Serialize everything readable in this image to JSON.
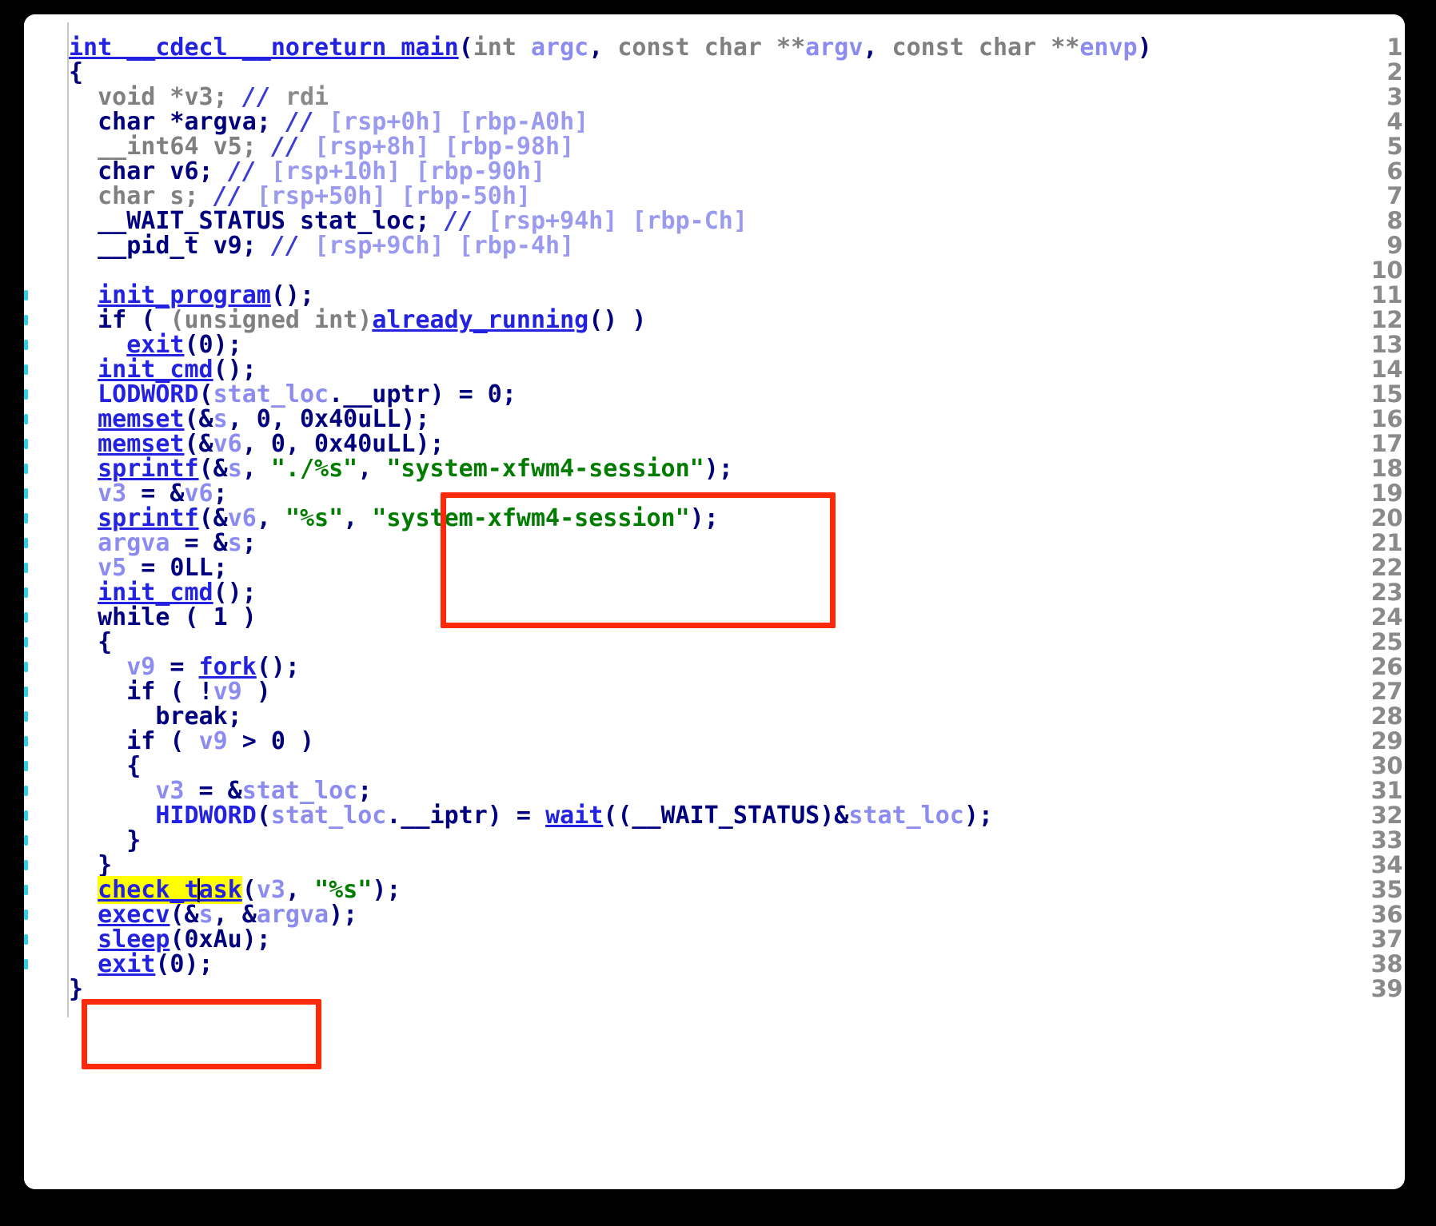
{
  "window": {
    "kind": "decompiler-pseudocode-view",
    "background": "#000000",
    "panel_background": "#ffffff"
  },
  "colors": {
    "keyword": "#00007e",
    "type_gray": "#808080",
    "function": "#2222e0",
    "variable": "#8c8cf0",
    "string": "#007c00",
    "comment": "#9a9aee",
    "highlight": "#ffff00",
    "annotation_box": "#fb2a0a",
    "gutter_text": "#8a8a8a",
    "edge_marker": "#2fd0e8"
  },
  "gutter": {
    "line_numbers": [
      "1",
      "2",
      "3",
      "4",
      "5",
      "6",
      "7",
      "8",
      "9",
      "10",
      "11",
      "12",
      "13",
      "14",
      "15",
      "16",
      "17",
      "18",
      "19",
      "20",
      "21",
      "22",
      "23",
      "24",
      "25",
      "26",
      "27",
      "28",
      "29",
      "30",
      "31",
      "32",
      "33",
      "34",
      "35",
      "36",
      "37",
      "38",
      "39"
    ],
    "marked_lines": [
      11,
      12,
      13,
      14,
      15,
      16,
      17,
      18,
      19,
      20,
      21,
      22,
      23,
      24,
      25,
      26,
      27,
      28,
      29,
      30,
      31,
      32,
      33,
      34,
      35,
      36,
      37,
      38
    ]
  },
  "code": {
    "language": "c-pseudocode",
    "function_signature": "int __cdecl __noreturn main(int argc, const char **argv, const char **envp)",
    "highlighted_identifier": "check_task",
    "caret_after": "check_t",
    "lines": [
      "int __cdecl __noreturn main(int argc, const char **argv, const char **envp)",
      "{",
      "  void *v3; // rdi",
      "  char *argva; // [rsp+0h] [rbp-A0h]",
      "  __int64 v5; // [rsp+8h] [rbp-98h]",
      "  char v6; // [rsp+10h] [rbp-90h]",
      "  char s; // [rsp+50h] [rbp-50h]",
      "  __WAIT_STATUS stat_loc; // [rsp+94h] [rbp-Ch]",
      "  __pid_t v9; // [rsp+9Ch] [rbp-4h]",
      "",
      "  init_program();",
      "  if ( (unsigned int)already_running() )",
      "    exit(0);",
      "  init_cmd();",
      "  LODWORD(stat_loc.__uptr) = 0;",
      "  memset(&s, 0, 0x40uLL);",
      "  memset(&v6, 0, 0x40uLL);",
      "  sprintf(&s, \"./%s\", \"system-xfwm4-session\");",
      "  v3 = &v6;",
      "  sprintf(&v6, \"%s\", \"system-xfwm4-session\");",
      "  argva = &s;",
      "  v5 = 0LL;",
      "  init_cmd();",
      "  while ( 1 )",
      "  {",
      "    v9 = fork();",
      "    if ( !v9 )",
      "      break;",
      "    if ( v9 > 0 )",
      "    {",
      "      v3 = &stat_loc;",
      "      HIDWORD(stat_loc.__iptr) = wait((__WAIT_STATUS)&stat_loc);",
      "    }",
      "  }",
      "  check_task(v3, \"%s\");",
      "  execv(&s, &argva);",
      "  sleep(0xAu);",
      "  exit(0);",
      "}"
    ],
    "strings": [
      "system-xfwm4-session",
      "./%s",
      "%s"
    ],
    "functions": [
      "main",
      "init_program",
      "already_running",
      "exit",
      "init_cmd",
      "LODWORD",
      "memset",
      "sprintf",
      "fork",
      "HIDWORD",
      "wait",
      "check_task",
      "execv",
      "sleep"
    ],
    "variables": [
      "v3",
      "argva",
      "v5",
      "v6",
      "s",
      "stat_loc",
      "v9",
      "argc",
      "argv",
      "envp"
    ],
    "comments": [
      "// rdi",
      "// [rsp+0h] [rbp-A0h]",
      "// [rsp+8h] [rbp-98h]",
      "// [rsp+10h] [rbp-90h]",
      "// [rsp+50h] [rbp-50h]",
      "// [rsp+94h] [rbp-Ch]",
      "// [rsp+9Ch] [rbp-4h]"
    ]
  },
  "annotations": [
    {
      "name": "string-literal-box",
      "target": "system-xfwm4-session string arguments on lines 17-20"
    },
    {
      "name": "check-task-call-box",
      "target": "check_task(v3, \"%s\") call on lines 34-36"
    }
  ]
}
